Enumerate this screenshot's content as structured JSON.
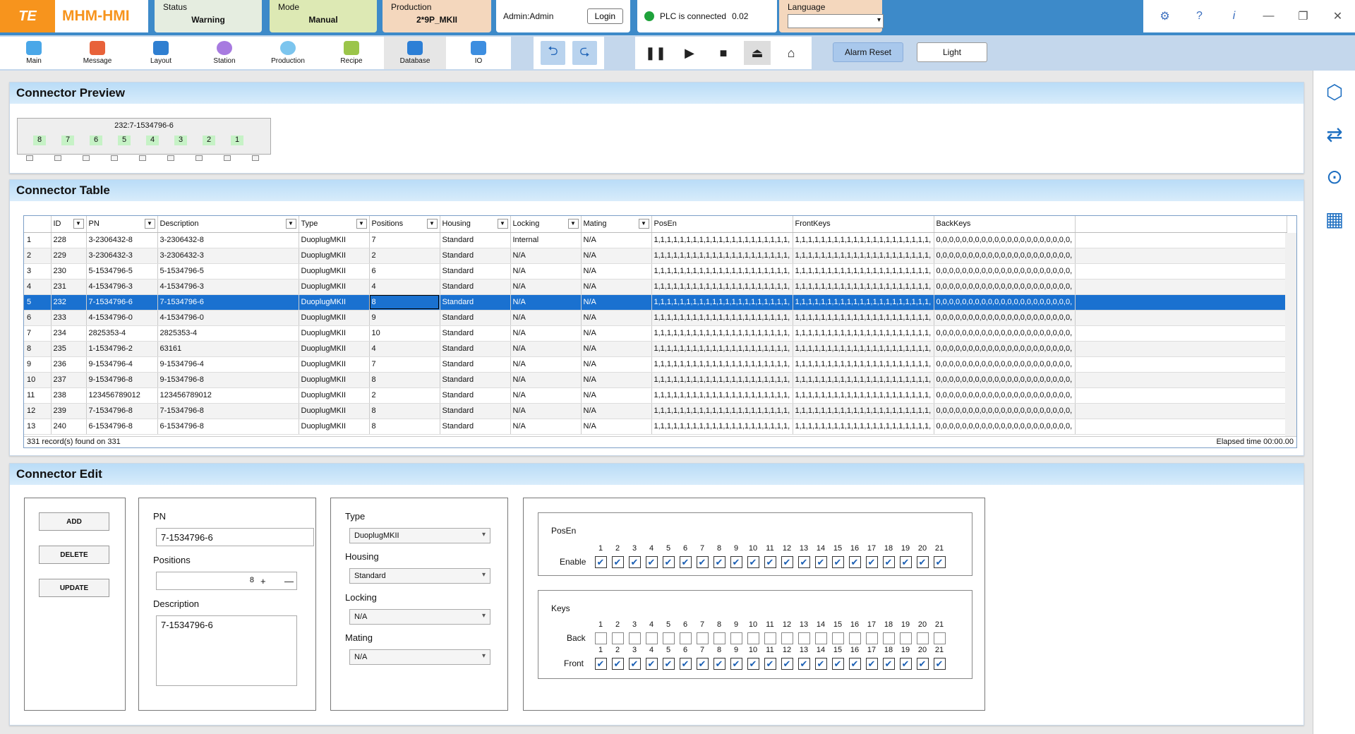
{
  "header": {
    "logo_text": "TE",
    "app_title": "MHM-HMI",
    "status_label": "Status",
    "status_value": "Warning",
    "mode_label": "Mode",
    "mode_value": "Manual",
    "production_label": "Production",
    "production_value": "2*9P_MKII",
    "user": "Admin:Admin",
    "login_label": "Login",
    "plc_status": "PLC is connected",
    "plc_value": "0.02",
    "language_label": "Language",
    "language_value": "",
    "icons": [
      "gear-icon",
      "help-icon",
      "info-icon",
      "minimize-icon",
      "restore-icon",
      "close-icon"
    ]
  },
  "nav": [
    {
      "label": "Main",
      "color": "#4aa7e8"
    },
    {
      "label": "Message",
      "color": "#e8623a"
    },
    {
      "label": "Layout",
      "color": "#2f7fd1"
    },
    {
      "label": "Station",
      "color": "#a77ae0"
    },
    {
      "label": "Production",
      "color": "#7cc5ee"
    },
    {
      "label": "Recipe",
      "color": "#9bc54a"
    },
    {
      "label": "Database",
      "color": "#2c7fd6"
    },
    {
      "label": "IO",
      "color": "#3d8ee0"
    }
  ],
  "toolbar": {
    "alarm_reset": "Alarm Reset",
    "light": "Light"
  },
  "preview": {
    "title": "Connector Preview",
    "connector_label": "232:7-1534796-6",
    "pins": [
      "8",
      "7",
      "6",
      "5",
      "4",
      "3",
      "2",
      "1"
    ]
  },
  "table": {
    "title": "Connector Table",
    "columns": [
      "ID",
      "PN",
      "Description",
      "Type",
      "Positions",
      "Housing",
      "Locking",
      "Mating",
      "PosEn",
      "FrontKeys",
      "BackKeys"
    ],
    "rows": [
      [
        "1",
        "228",
        "3-2306432-8",
        "3-2306432-8",
        "DuoplugMKII",
        "7",
        "Standard",
        "Internal",
        "N/A",
        "1,1,1,1,1,1,1,1,1,1,1,1,1,1,1,1,1,1,1,1,1,",
        "1,1,1,1,1,1,1,1,1,1,1,1,1,1,1,1,1,1,1,1,1,",
        "0,0,0,0,0,0,0,0,0,0,0,0,0,0,0,0,0,0,0,0,0,"
      ],
      [
        "2",
        "229",
        "3-2306432-3",
        "3-2306432-3",
        "DuoplugMKII",
        "2",
        "Standard",
        "N/A",
        "N/A",
        "1,1,1,1,1,1,1,1,1,1,1,1,1,1,1,1,1,1,1,1,1,",
        "1,1,1,1,1,1,1,1,1,1,1,1,1,1,1,1,1,1,1,1,1,",
        "0,0,0,0,0,0,0,0,0,0,0,0,0,0,0,0,0,0,0,0,0,"
      ],
      [
        "3",
        "230",
        "5-1534796-5",
        "5-1534796-5",
        "DuoplugMKII",
        "6",
        "Standard",
        "N/A",
        "N/A",
        "1,1,1,1,1,1,1,1,1,1,1,1,1,1,1,1,1,1,1,1,1,",
        "1,1,1,1,1,1,1,1,1,1,1,1,1,1,1,1,1,1,1,1,1,",
        "0,0,0,0,0,0,0,0,0,0,0,0,0,0,0,0,0,0,0,0,0,"
      ],
      [
        "4",
        "231",
        "4-1534796-3",
        "4-1534796-3",
        "DuoplugMKII",
        "4",
        "Standard",
        "N/A",
        "N/A",
        "1,1,1,1,1,1,1,1,1,1,1,1,1,1,1,1,1,1,1,1,1,",
        "1,1,1,1,1,1,1,1,1,1,1,1,1,1,1,1,1,1,1,1,1,",
        "0,0,0,0,0,0,0,0,0,0,0,0,0,0,0,0,0,0,0,0,0,"
      ],
      [
        "5",
        "232",
        "7-1534796-6",
        "7-1534796-6",
        "DuoplugMKII",
        "8",
        "Standard",
        "N/A",
        "N/A",
        "1,1,1,1,1,1,1,1,1,1,1,1,1,1,1,1,1,1,1,1,1,",
        "1,1,1,1,1,1,1,1,1,1,1,1,1,1,1,1,1,1,1,1,1,",
        "0,0,0,0,0,0,0,0,0,0,0,0,0,0,0,0,0,0,0,0,0,"
      ],
      [
        "6",
        "233",
        "4-1534796-0",
        "4-1534796-0",
        "DuoplugMKII",
        "9",
        "Standard",
        "N/A",
        "N/A",
        "1,1,1,1,1,1,1,1,1,1,1,1,1,1,1,1,1,1,1,1,1,",
        "1,1,1,1,1,1,1,1,1,1,1,1,1,1,1,1,1,1,1,1,1,",
        "0,0,0,0,0,0,0,0,0,0,0,0,0,0,0,0,0,0,0,0,0,"
      ],
      [
        "7",
        "234",
        "2825353-4",
        "2825353-4",
        "DuoplugMKII",
        "10",
        "Standard",
        "N/A",
        "N/A",
        "1,1,1,1,1,1,1,1,1,1,1,1,1,1,1,1,1,1,1,1,1,",
        "1,1,1,1,1,1,1,1,1,1,1,1,1,1,1,1,1,1,1,1,1,",
        "0,0,0,0,0,0,0,0,0,0,0,0,0,0,0,0,0,0,0,0,0,"
      ],
      [
        "8",
        "235",
        "1-1534796-2",
        "63161",
        "DuoplugMKII",
        "4",
        "Standard",
        "N/A",
        "N/A",
        "1,1,1,1,1,1,1,1,1,1,1,1,1,1,1,1,1,1,1,1,1,",
        "1,1,1,1,1,1,1,1,1,1,1,1,1,1,1,1,1,1,1,1,1,",
        "0,0,0,0,0,0,0,0,0,0,0,0,0,0,0,0,0,0,0,0,0,"
      ],
      [
        "9",
        "236",
        "9-1534796-4",
        "9-1534796-4",
        "DuoplugMKII",
        "7",
        "Standard",
        "N/A",
        "N/A",
        "1,1,1,1,1,1,1,1,1,1,1,1,1,1,1,1,1,1,1,1,1,",
        "1,1,1,1,1,1,1,1,1,1,1,1,1,1,1,1,1,1,1,1,1,",
        "0,0,0,0,0,0,0,0,0,0,0,0,0,0,0,0,0,0,0,0,0,"
      ],
      [
        "10",
        "237",
        "9-1534796-8",
        "9-1534796-8",
        "DuoplugMKII",
        "8",
        "Standard",
        "N/A",
        "N/A",
        "1,1,1,1,1,1,1,1,1,1,1,1,1,1,1,1,1,1,1,1,1,",
        "1,1,1,1,1,1,1,1,1,1,1,1,1,1,1,1,1,1,1,1,1,",
        "0,0,0,0,0,0,0,0,0,0,0,0,0,0,0,0,0,0,0,0,0,"
      ],
      [
        "11",
        "238",
        "123456789012",
        "123456789012",
        "DuoplugMKII",
        "2",
        "Standard",
        "N/A",
        "N/A",
        "1,1,1,1,1,1,1,1,1,1,1,1,1,1,1,1,1,1,1,1,1,",
        "1,1,1,1,1,1,1,1,1,1,1,1,1,1,1,1,1,1,1,1,1,",
        "0,0,0,0,0,0,0,0,0,0,0,0,0,0,0,0,0,0,0,0,0,"
      ],
      [
        "12",
        "239",
        "7-1534796-8",
        "7-1534796-8",
        "DuoplugMKII",
        "8",
        "Standard",
        "N/A",
        "N/A",
        "1,1,1,1,1,1,1,1,1,1,1,1,1,1,1,1,1,1,1,1,1,",
        "1,1,1,1,1,1,1,1,1,1,1,1,1,1,1,1,1,1,1,1,1,",
        "0,0,0,0,0,0,0,0,0,0,0,0,0,0,0,0,0,0,0,0,0,"
      ],
      [
        "13",
        "240",
        "6-1534796-8",
        "6-1534796-8",
        "DuoplugMKII",
        "8",
        "Standard",
        "N/A",
        "N/A",
        "1,1,1,1,1,1,1,1,1,1,1,1,1,1,1,1,1,1,1,1,1,",
        "1,1,1,1,1,1,1,1,1,1,1,1,1,1,1,1,1,1,1,1,1,",
        "0,0,0,0,0,0,0,0,0,0,0,0,0,0,0,0,0,0,0,0,0,"
      ]
    ],
    "selected_row": 5,
    "records_text": "331 record(s) found on 331",
    "elapsed_text": "Elapsed time 00:00.00"
  },
  "edit": {
    "title": "Connector Edit",
    "add_label": "ADD",
    "delete_label": "DELETE",
    "update_label": "UPDATE",
    "pn_label": "PN",
    "pn_value": "7-1534796-6",
    "positions_label": "Positions",
    "positions_value": "8",
    "description_label": "Description",
    "description_value": "7-1534796-6",
    "type_label": "Type",
    "type_value": "DuoplugMKII",
    "housing_label": "Housing",
    "housing_value": "Standard",
    "locking_label": "Locking",
    "locking_value": "N/A",
    "mating_label": "Mating",
    "mating_value": "N/A",
    "posen_title": "PosEn",
    "enable_label": "Enable",
    "keys_title": "Keys",
    "back_label": "Back",
    "front_label": "Front",
    "numbers": [
      "1",
      "2",
      "3",
      "4",
      "5",
      "6",
      "7",
      "8",
      "9",
      "10",
      "11",
      "12",
      "13",
      "14",
      "15",
      "16",
      "17",
      "18",
      "19",
      "20",
      "21"
    ],
    "posen_checked": true,
    "back_checked": false,
    "front_checked": true
  }
}
